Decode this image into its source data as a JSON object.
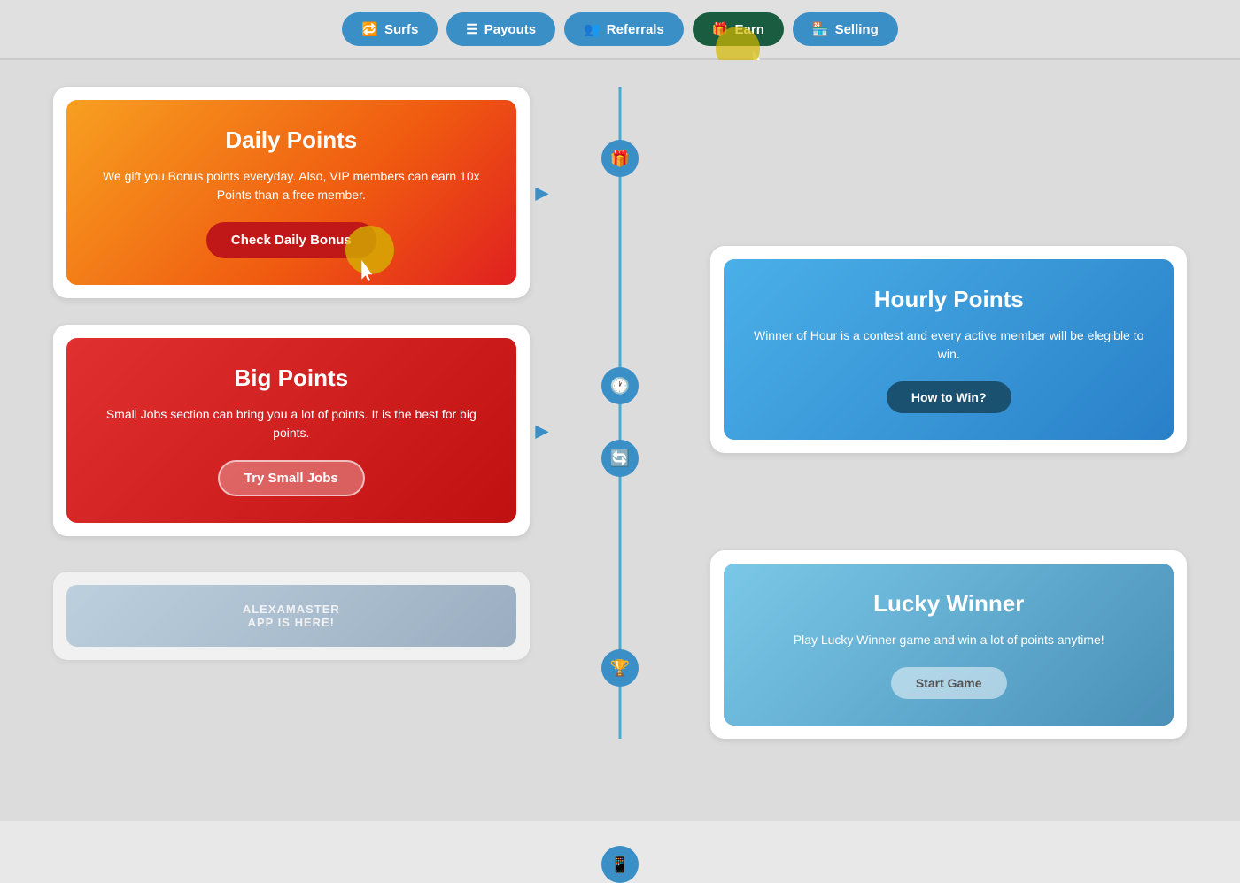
{
  "nav": {
    "items": [
      {
        "id": "surfs",
        "label": "Surfs",
        "icon": "🔁",
        "active": false
      },
      {
        "id": "payouts",
        "label": "Payouts",
        "icon": "≡",
        "active": false
      },
      {
        "id": "referrals",
        "label": "Referrals",
        "icon": "👥",
        "active": false
      },
      {
        "id": "earn",
        "label": "Earn",
        "icon": "🎁",
        "active": true
      },
      {
        "id": "selling",
        "label": "Selling",
        "icon": "🏪",
        "active": false
      }
    ]
  },
  "cards": {
    "daily_points": {
      "title": "Daily Points",
      "description": "We gift you Bonus points everyday. Also, VIP members can earn 10x Points than a free member.",
      "button_label": "Check Daily Bonus"
    },
    "big_points": {
      "title": "Big Points",
      "description": "Small Jobs section can bring you a lot of points. It is the best for big points.",
      "button_label": "Try Small Jobs"
    },
    "hourly_points": {
      "title": "Hourly Points",
      "description": "Winner of Hour is a contest and every active member will be elegible to win.",
      "button_label": "How to Win?"
    },
    "lucky_winner": {
      "title": "Lucky Winner",
      "description": "Play Lucky Winner game and win a lot of points anytime!",
      "button_label": "Start Game"
    }
  },
  "app_banner": {
    "line1": "alexamaster",
    "line2": "APP IS HERE!"
  }
}
